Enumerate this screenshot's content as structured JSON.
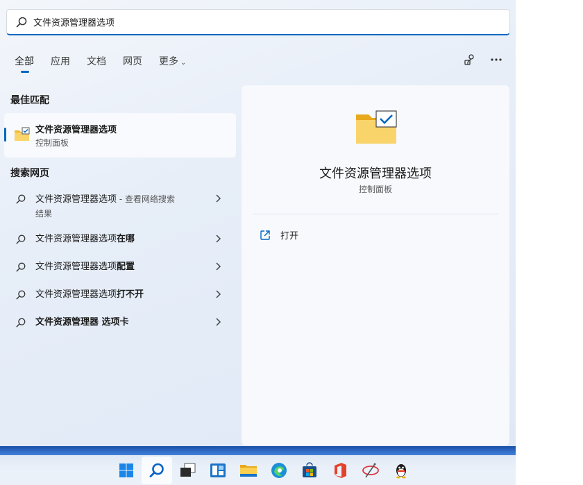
{
  "search": {
    "value": "文件资源管理器选项"
  },
  "tabs": [
    {
      "label": "全部"
    },
    {
      "label": "应用"
    },
    {
      "label": "文档"
    },
    {
      "label": "网页"
    },
    {
      "label": "更多"
    }
  ],
  "sections": {
    "best_match": "最佳匹配",
    "search_web": "搜索网页"
  },
  "best_match": {
    "title": "文件资源管理器选项",
    "subtitle": "控制面板"
  },
  "web_results": [
    {
      "prefix": "文件资源管理器选项",
      "suffix": "",
      "hint": " - 查看网络搜索",
      "hint2": "结果"
    },
    {
      "prefix": "文件资源管理器选项",
      "suffix": "在哪",
      "hint": "",
      "hint2": ""
    },
    {
      "prefix": "文件资源管理器选项",
      "suffix": "配置",
      "hint": "",
      "hint2": ""
    },
    {
      "prefix": "文件资源管理器选项",
      "suffix": "打不开",
      "hint": "",
      "hint2": ""
    },
    {
      "prefix": "文件资源管理器",
      "suffix": " 选项卡",
      "hint": "",
      "hint2": ""
    }
  ],
  "detail": {
    "title": "文件资源管理器选项",
    "subtitle": "控制面板",
    "action_open": "打开"
  },
  "icons": {
    "search": "search-icon",
    "share": "account-switch-icon",
    "more": "more-icon",
    "open": "open-external-icon"
  },
  "colors": {
    "accent": "#0067c0",
    "folder": "#f7c948"
  }
}
